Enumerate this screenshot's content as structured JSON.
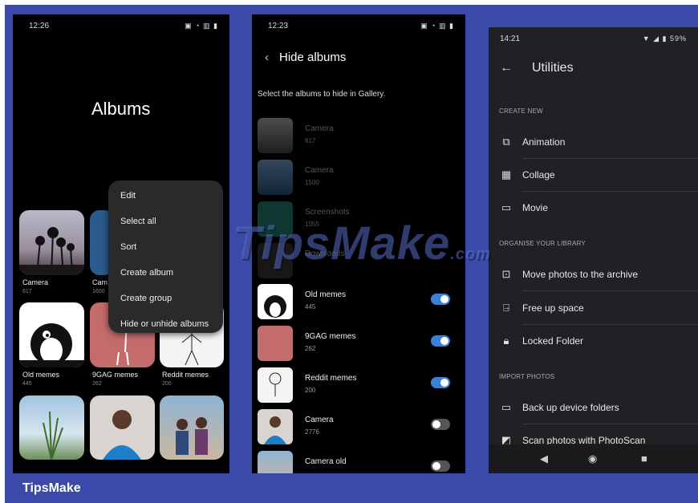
{
  "screen1": {
    "time": "12:26",
    "title": "Albums",
    "menu": [
      "Edit",
      "Select all",
      "Sort",
      "Create album",
      "Create group",
      "Hide or unhide albums"
    ],
    "albums": [
      {
        "name": "Camera",
        "count": "617"
      },
      {
        "name": "Cam",
        "count": "1600"
      },
      {
        "name": "Old memes",
        "count": "445"
      },
      {
        "name": "9GAG memes",
        "count": "262"
      },
      {
        "name": "Reddit memes",
        "count": "200"
      }
    ]
  },
  "screen2": {
    "time": "12:23",
    "title": "Hide albums",
    "hint": "Select the albums to hide in Gallery.",
    "albums": [
      {
        "name": "Camera",
        "count": "617",
        "toggle": null
      },
      {
        "name": "Camera",
        "count": "1500",
        "toggle": null
      },
      {
        "name": "Screenshots",
        "count": "1055",
        "toggle": null
      },
      {
        "name": "Downloads",
        "count": "",
        "toggle": null
      },
      {
        "name": "Old memes",
        "count": "445",
        "toggle": "on"
      },
      {
        "name": "9GAG memes",
        "count": "262",
        "toggle": "on"
      },
      {
        "name": "Reddit memes",
        "count": "200",
        "toggle": "on"
      },
      {
        "name": "Camera",
        "count": "2776",
        "toggle": "off"
      },
      {
        "name": "Camera old",
        "count": "",
        "toggle": "off"
      }
    ]
  },
  "screen3": {
    "time": "14:21",
    "battery": "59%",
    "title": "Utilities",
    "sections": [
      {
        "label": "CREATE NEW",
        "items": [
          {
            "label": "Animation",
            "icon": "animation-icon"
          },
          {
            "label": "Collage",
            "icon": "collage-icon"
          },
          {
            "label": "Movie",
            "icon": "movie-icon"
          }
        ]
      },
      {
        "label": "ORGANISE YOUR LIBRARY",
        "items": [
          {
            "label": "Move photos to the archive",
            "icon": "archive-icon"
          },
          {
            "label": "Free up space",
            "icon": "free-space-icon"
          },
          {
            "label": "Locked Folder",
            "icon": "lock-icon"
          }
        ]
      },
      {
        "label": "IMPORT PHOTOS",
        "items": [
          {
            "label": "Back up device folders",
            "icon": "folder-icon"
          },
          {
            "label": "Scan photos with PhotoScan",
            "icon": "photoscan-icon"
          }
        ]
      }
    ]
  },
  "watermark": {
    "text": "TipsMake",
    "suffix": ".com"
  },
  "footer": {
    "brand": "TipsMake"
  },
  "colors": {
    "accent": "#3b4aa8",
    "toggle_on": "#3a82d9"
  }
}
